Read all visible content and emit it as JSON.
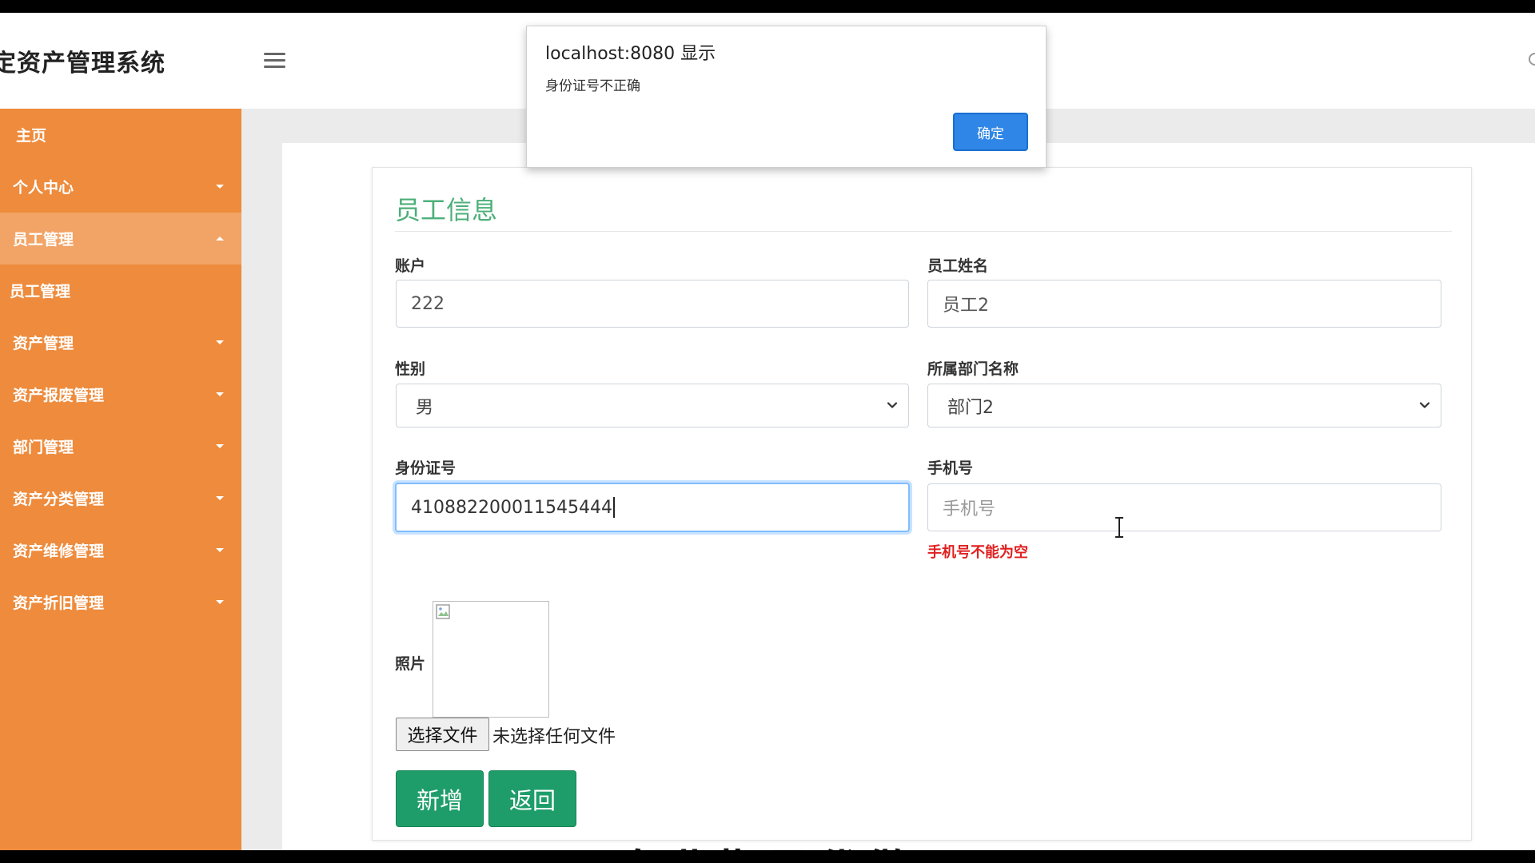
{
  "app": {
    "title": "定资产管理系统"
  },
  "sidebar": {
    "items": [
      {
        "label": "主页",
        "caret": "none",
        "active": false
      },
      {
        "label": "个人中心",
        "caret": "down",
        "active": false
      },
      {
        "label": "员工管理",
        "caret": "up",
        "active": true
      },
      {
        "label": "员工管理",
        "caret": "none",
        "active": false
      },
      {
        "label": "资产管理",
        "caret": "down",
        "active": false
      },
      {
        "label": "资产报废管理",
        "caret": "down",
        "active": false
      },
      {
        "label": "部门管理",
        "caret": "down",
        "active": false
      },
      {
        "label": "资产分类管理",
        "caret": "down",
        "active": false
      },
      {
        "label": "资产维修管理",
        "caret": "down",
        "active": false
      },
      {
        "label": "资产折旧管理",
        "caret": "down",
        "active": false
      }
    ]
  },
  "form": {
    "title": "员工信息",
    "account": {
      "label": "账户",
      "value": "222"
    },
    "name": {
      "label": "员工姓名",
      "value": "员工2"
    },
    "gender": {
      "label": "性别",
      "value": "男"
    },
    "department": {
      "label": "所属部门名称",
      "value": "部门2"
    },
    "id_number": {
      "label": "身份证号",
      "value": "410882200011545444"
    },
    "phone": {
      "label": "手机号",
      "placeholder": "手机号",
      "error": "手机号不能为空"
    },
    "photo": {
      "label": "照片",
      "file_button": "选择文件",
      "file_status": "未选择任何文件"
    },
    "buttons": {
      "add": "新增",
      "back": "返回"
    }
  },
  "alert": {
    "title": "localhost:8080 显示",
    "message": "身份证号不正确",
    "ok": "确定"
  },
  "background_text": "专业指导代做",
  "colors": {
    "sidebar": "#ee8b3c",
    "sidebar_active": "#f2a366",
    "title_green": "#4caf7a",
    "button_green": "#1e9d6a",
    "error_red": "#e02020",
    "alert_button": "#2f86e6"
  },
  "icons": [
    "hamburger-menu-icon",
    "chevron-down-icon",
    "caret-down-icon",
    "caret-up-icon",
    "broken-image-icon",
    "text-cursor-icon"
  ]
}
